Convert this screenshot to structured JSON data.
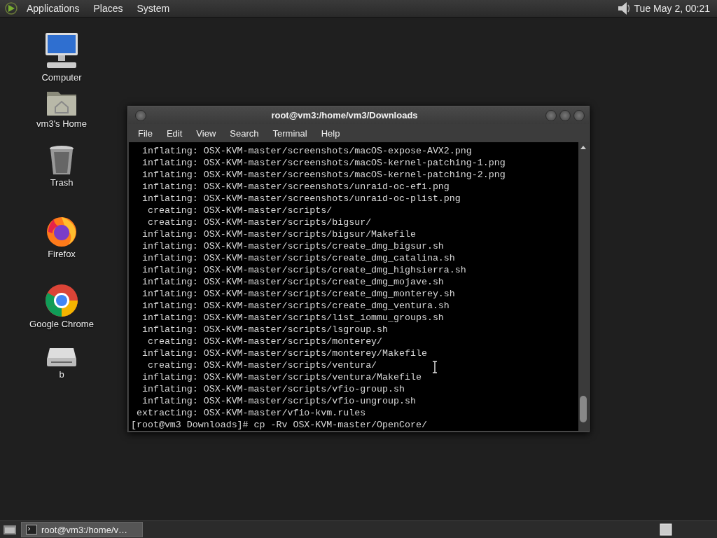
{
  "top_panel": {
    "menus": [
      "Applications",
      "Places",
      "System"
    ],
    "clock": "Tue May  2, 00:21"
  },
  "desktop_icons": [
    {
      "kind": "computer",
      "label": "Computer"
    },
    {
      "kind": "home",
      "label": "vm3's Home"
    },
    {
      "kind": "trash",
      "label": "Trash"
    },
    {
      "kind": "firefox",
      "label": "Firefox"
    },
    {
      "kind": "chrome",
      "label": "Google Chrome"
    },
    {
      "kind": "drive",
      "label": "b"
    }
  ],
  "terminal": {
    "title": "root@vm3:/home/vm3/Downloads",
    "menu": [
      "File",
      "Edit",
      "View",
      "Search",
      "Terminal",
      "Help"
    ],
    "lines": [
      "  inflating: OSX-KVM-master/screenshots/macOS-expose-AVX2.png",
      "  inflating: OSX-KVM-master/screenshots/macOS-kernel-patching-1.png",
      "  inflating: OSX-KVM-master/screenshots/macOS-kernel-patching-2.png",
      "  inflating: OSX-KVM-master/screenshots/unraid-oc-efi.png",
      "  inflating: OSX-KVM-master/screenshots/unraid-oc-plist.png",
      "   creating: OSX-KVM-master/scripts/",
      "   creating: OSX-KVM-master/scripts/bigsur/",
      "  inflating: OSX-KVM-master/scripts/bigsur/Makefile",
      "  inflating: OSX-KVM-master/scripts/create_dmg_bigsur.sh",
      "  inflating: OSX-KVM-master/scripts/create_dmg_catalina.sh",
      "  inflating: OSX-KVM-master/scripts/create_dmg_highsierra.sh",
      "  inflating: OSX-KVM-master/scripts/create_dmg_mojave.sh",
      "  inflating: OSX-KVM-master/scripts/create_dmg_monterey.sh",
      "  inflating: OSX-KVM-master/scripts/create_dmg_ventura.sh",
      "  inflating: OSX-KVM-master/scripts/list_iommu_groups.sh",
      "  inflating: OSX-KVM-master/scripts/lsgroup.sh",
      "   creating: OSX-KVM-master/scripts/monterey/",
      "  inflating: OSX-KVM-master/scripts/monterey/Makefile",
      "   creating: OSX-KVM-master/scripts/ventura/",
      "  inflating: OSX-KVM-master/scripts/ventura/Makefile",
      "  inflating: OSX-KVM-master/scripts/vfio-group.sh",
      "  inflating: OSX-KVM-master/scripts/vfio-ungroup.sh",
      " extracting: OSX-KVM-master/vfio-kvm.rules",
      "[root@vm3 Downloads]# cp -Rv OSX-KVM-master/OpenCore/"
    ]
  },
  "taskbar": {
    "tasks": [
      {
        "label": "root@vm3:/home/v…",
        "selected": true
      }
    ]
  }
}
